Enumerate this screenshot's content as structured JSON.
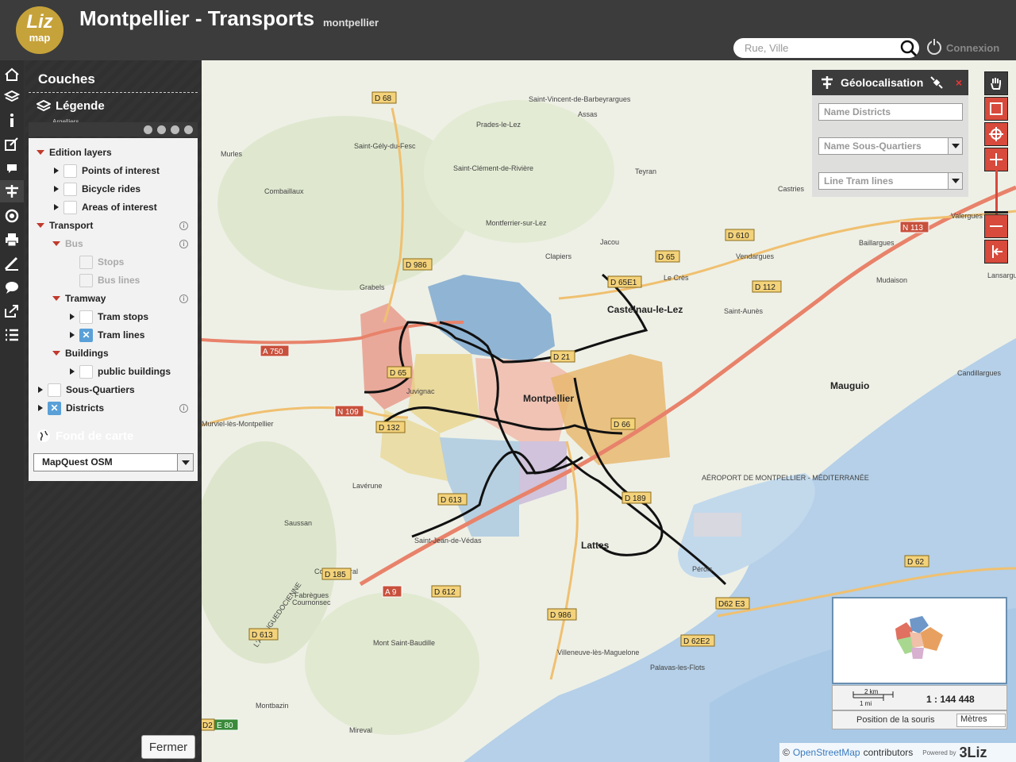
{
  "header": {
    "logo_top": "Liz",
    "logo_bottom": "map",
    "title": "Montpellier - Transports",
    "subtitle": "montpellier",
    "search_placeholder": "Rue, Ville",
    "connexion": "Connexion"
  },
  "mapmenu": {
    "items": [
      "home-icon",
      "layers-icon",
      "info-icon",
      "edit-icon",
      "comment-icon",
      "transport-icon",
      "locate-icon",
      "print-icon",
      "measure-icon",
      "chat-icon",
      "share-icon",
      "list-icon"
    ]
  },
  "panel": {
    "title": "Couches",
    "legend_title": "Légende",
    "tree": [
      {
        "label": "Edition layers"
      },
      {
        "label": "Points of interest"
      },
      {
        "label": "Bicycle rides"
      },
      {
        "label": "Areas of interest"
      },
      {
        "label": "Transport"
      },
      {
        "label": "Bus"
      },
      {
        "label": "Stops"
      },
      {
        "label": "Bus lines"
      },
      {
        "label": "Tramway"
      },
      {
        "label": "Tram stops"
      },
      {
        "label": "Tram lines"
      },
      {
        "label": "Buildings"
      },
      {
        "label": "public buildings"
      },
      {
        "label": "Sous-Quartiers"
      },
      {
        "label": "Districts"
      }
    ],
    "basemap_title": "Fond de carte",
    "basemap_value": "MapQuest OSM",
    "close": "Fermer",
    "partial_label": "Argelliers"
  },
  "geoloc": {
    "title": "Géolocalisation",
    "close": "×",
    "field1": "Name Districts",
    "field2": "Name Sous-Quartiers",
    "field3": "Line Tram lines"
  },
  "map": {
    "places": [
      "Saint-Vincent-de-Barbeyrargues",
      "Assas",
      "Prades-le-Lez",
      "Saint-Gély-du-Fesc",
      "Murles",
      "Saint-Clément-de-Rivière",
      "Teyran",
      "Combaillaux",
      "Castries",
      "Montferrier-sur-Lez",
      "Jacou",
      "Clapiers",
      "Vendargues",
      "Baillargues",
      "Valergues",
      "Grabels",
      "Le Crès",
      "Castelnau-le-Lez",
      "Saint-Aunès",
      "Mudaison",
      "Lansargues",
      "Candillargues",
      "Mauguio",
      "Montpellier",
      "Juvignac",
      "Murviel-lès-Montpellier",
      "Lavérune",
      "Saussan",
      "Saint-Jean-de-Védas",
      "Lattes",
      "Pérols",
      "Fabrègues",
      "Villeneuve-lès-Maguelone",
      "Palavas-les-Flots",
      "Mireval",
      "Montbazin",
      "Cournonterral",
      "Cournonsec",
      "Mont Saint-Baudille",
      "AÉROPORT DE MONTPELLIER - MÉDITERRANÉE",
      "L'ALANGUEDOCIENNE"
    ],
    "roads": [
      "D 68",
      "D 986",
      "D 65",
      "D 610",
      "N 113",
      "D 112",
      "D 65E1",
      "D 21",
      "A 750",
      "D 65",
      "N 109",
      "D 132",
      "D 66",
      "D 613",
      "D 189",
      "D 185",
      "A 9",
      "D 612",
      "D 986",
      "D 62",
      "D62 E3",
      "D 62E2",
      "D 613",
      "E 80",
      "D2"
    ]
  },
  "scale": {
    "km": "2 km",
    "mi": "1 mi",
    "ratio": "1 : 144 448"
  },
  "mousepos": {
    "label": "Position de la souris",
    "unit": "Mètres"
  },
  "attribution": {
    "copy": "©",
    "link": "OpenStreetMap",
    "text": "contributors",
    "powered": "Powered by",
    "brand": "3Liz"
  },
  "colors": {
    "header": "#3c3c3c",
    "accent": "#c6a23a",
    "red": "#d74a3c"
  }
}
